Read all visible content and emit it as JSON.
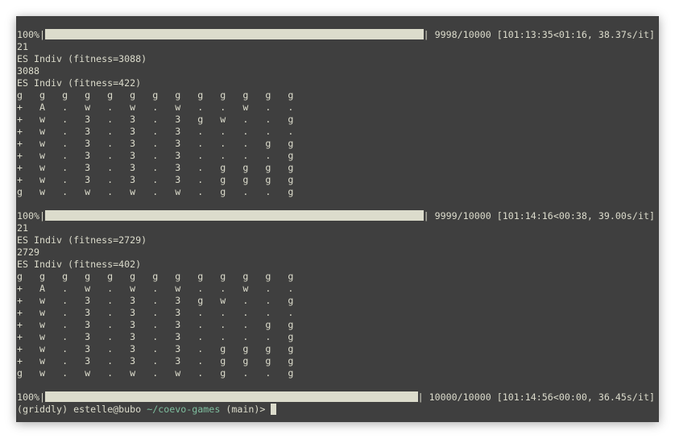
{
  "blocks": [
    {
      "progress": {
        "percent_label": "100%",
        "fill": 0.9998,
        "stats": "9998/10000 [101:13:35<01:16, 38.37s/it]"
      },
      "lines": [
        "21",
        "ES Indiv (fitness=3088)",
        "3088",
        "ES Indiv (fitness=422)"
      ],
      "grid": [
        "g   g   g   g   g   g   g   g   g   g   g   g   g",
        "+   A   .   w   .   w   .   w   .   .   w   .   .",
        "+   w   .   3   .   3   .   3   g   w   .   .   g",
        "+   w   .   3   .   3   .   3   .   .   .   .   .",
        "+   w   .   3   .   3   .   3   .   .   .   g   g",
        "+   w   .   3   .   3   .   3   .   .   .   .   g",
        "+   w   .   3   .   3   .   3   .   g   g   g   g",
        "+   w   .   3   .   3   .   3   .   g   g   g   g",
        "g   w   .   w   .   w   .   w   .   g   .   .   g"
      ]
    },
    {
      "progress": {
        "percent_label": "100%",
        "fill": 0.9999,
        "stats": "9999/10000 [101:14:16<00:38, 39.00s/it]"
      },
      "lines": [
        "21",
        "ES Indiv (fitness=2729)",
        "2729",
        "ES Indiv (fitness=402)"
      ],
      "grid": [
        "g   g   g   g   g   g   g   g   g   g   g   g   g",
        "+   A   .   w   .   w   .   w   .   .   w   .   .",
        "+   w   .   3   .   3   .   3   g   w   .   .   g",
        "+   w   .   3   .   3   .   3   .   .   .   .   .",
        "+   w   .   3   .   3   .   3   .   .   .   g   g",
        "+   w   .   3   .   3   .   3   .   .   .   .   g",
        "+   w   .   3   .   3   .   3   .   g   g   g   g",
        "+   w   .   3   .   3   .   3   .   g   g   g   g",
        "g   w   .   w   .   w   .   w   .   g   .   .   g"
      ]
    }
  ],
  "final_progress": {
    "percent_label": "100%",
    "fill": 1.0,
    "stats": "10000/10000 [101:14:56<00:00, 36.45s/it]"
  },
  "prompt": {
    "env": "(griddly)",
    "user_host": "estelle@bubo",
    "path": "~/coevo-games",
    "branch": "(main)>"
  },
  "colors": {
    "background": "#3f3f3f",
    "text": "#dcdccc",
    "path": "#7fbf9f"
  }
}
